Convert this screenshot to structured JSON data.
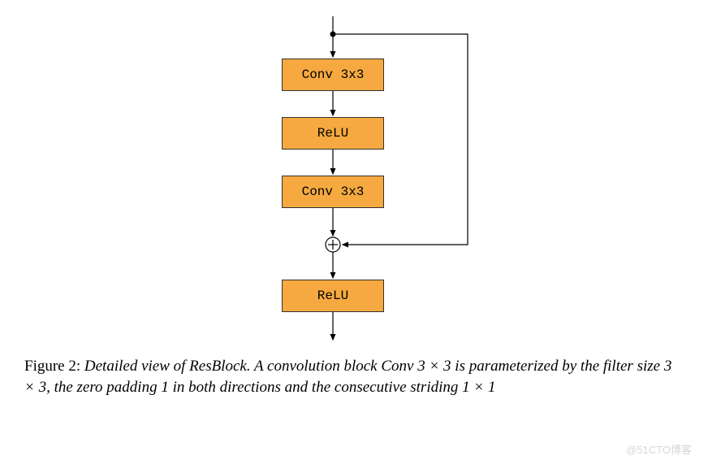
{
  "diagram": {
    "blocks": {
      "conv1": "Conv 3x3",
      "relu1": "ReLU",
      "conv2": "Conv 3x3",
      "relu2": "ReLU"
    }
  },
  "caption": {
    "label": "Figure 2:",
    "text_before": "Detailed view of ResBlock. A convolution block Conv ",
    "math1": "3 × 3",
    "text_mid1": " is parameterized by the filter size ",
    "math2": "3 × 3",
    "text_mid2": ", the zero padding 1 in both directions and the consecutive striding ",
    "math3": "1 × 1"
  },
  "watermark": "@51CTO博客"
}
